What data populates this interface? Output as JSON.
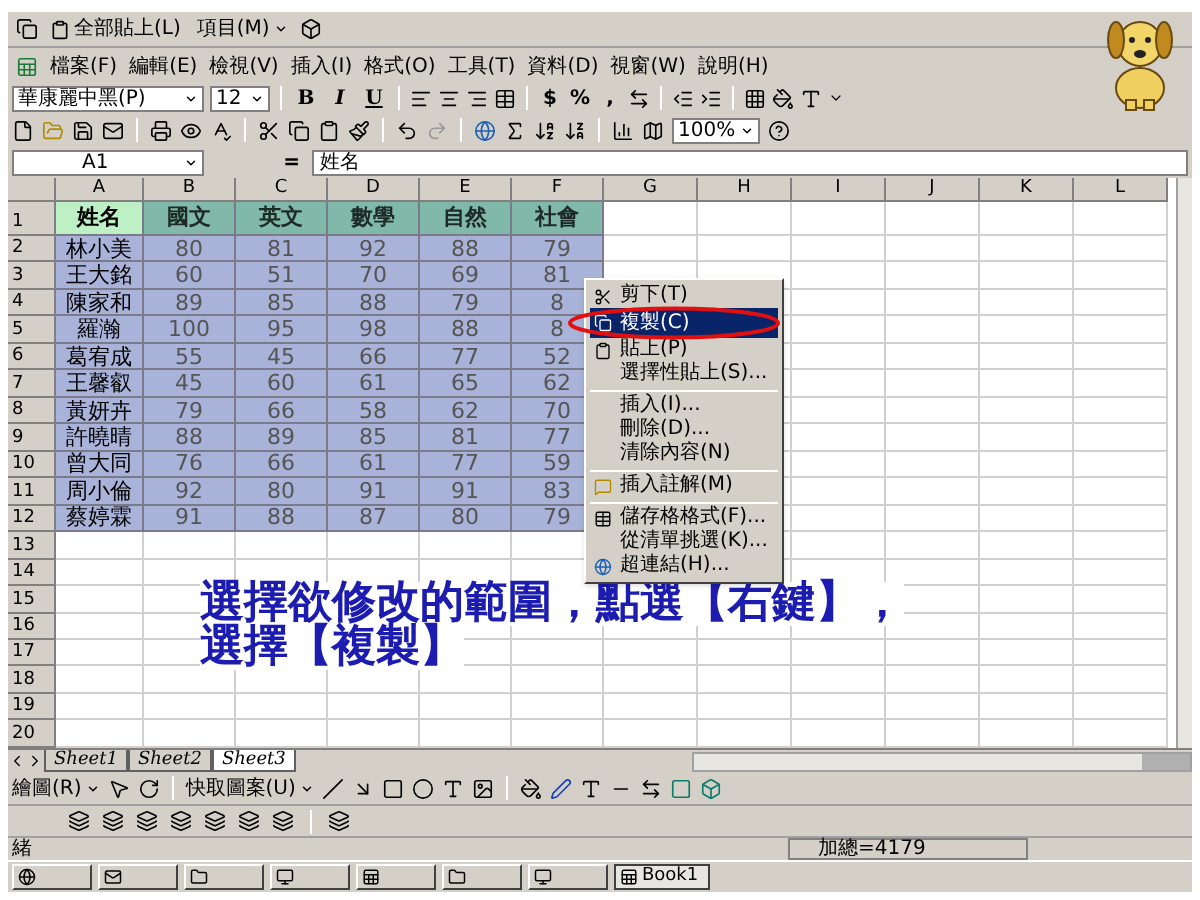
{
  "clipboard_toolbar": {
    "items": [
      {
        "label": "全部貼上(L)",
        "kind": "button"
      },
      {
        "label": "項目(M)",
        "kind": "dropdown"
      }
    ]
  },
  "menu_bar": [
    "檔案(F)",
    "編輯(E)",
    "檢視(V)",
    "插入(I)",
    "格式(O)",
    "工具(T)",
    "資料(D)",
    "視窗(W)",
    "說明(H)"
  ],
  "format_toolbar": {
    "font": "華康麗中黑(P)",
    "size": "12",
    "style_buttons": [
      "B",
      "I",
      "U"
    ],
    "number_buttons": [
      "$",
      "%",
      ","
    ]
  },
  "standard_toolbar": {
    "zoom": "100%"
  },
  "formula_bar": {
    "cell": "A1",
    "equals": "=",
    "value": "姓名"
  },
  "columns": [
    "A",
    "B",
    "C",
    "D",
    "E",
    "F",
    "G",
    "H",
    "I",
    "J",
    "K",
    "L"
  ],
  "rows": [
    {
      "number": "1",
      "kind": "header",
      "cells": [
        "姓名",
        "國文",
        "英文",
        "數學",
        "自然",
        "社會"
      ]
    },
    {
      "number": "2",
      "kind": "data",
      "cells": [
        "林小美",
        "80",
        "81",
        "92",
        "88",
        "79"
      ]
    },
    {
      "number": "3",
      "kind": "data",
      "cells": [
        "王大銘",
        "60",
        "51",
        "70",
        "69",
        "81"
      ]
    },
    {
      "number": "4",
      "kind": "data",
      "cells": [
        "陳家和",
        "89",
        "85",
        "88",
        "79",
        "8"
      ]
    },
    {
      "number": "5",
      "kind": "data",
      "cells": [
        "羅瀚",
        "100",
        "95",
        "98",
        "88",
        "8"
      ]
    },
    {
      "number": "6",
      "kind": "data",
      "cells": [
        "葛宥成",
        "55",
        "45",
        "66",
        "77",
        "52"
      ]
    },
    {
      "number": "7",
      "kind": "data",
      "cells": [
        "王馨叡",
        "45",
        "60",
        "61",
        "65",
        "62"
      ]
    },
    {
      "number": "8",
      "kind": "data",
      "cells": [
        "黃妍卉",
        "79",
        "66",
        "58",
        "62",
        "70"
      ]
    },
    {
      "number": "9",
      "kind": "data",
      "cells": [
        "許曉晴",
        "88",
        "89",
        "85",
        "81",
        "77"
      ]
    },
    {
      "number": "10",
      "kind": "data",
      "cells": [
        "曾大同",
        "76",
        "66",
        "61",
        "77",
        "59"
      ]
    },
    {
      "number": "11",
      "kind": "data",
      "cells": [
        "周小倫",
        "92",
        "80",
        "91",
        "91",
        "83"
      ]
    },
    {
      "number": "12",
      "kind": "data",
      "cells": [
        "蔡婷霖",
        "91",
        "88",
        "87",
        "80",
        "79"
      ]
    },
    {
      "number": "13",
      "kind": "empty"
    },
    {
      "number": "14",
      "kind": "empty"
    },
    {
      "number": "15",
      "kind": "empty"
    },
    {
      "number": "16",
      "kind": "empty"
    },
    {
      "number": "17",
      "kind": "empty"
    },
    {
      "number": "18",
      "kind": "empty"
    },
    {
      "number": "19",
      "kind": "empty"
    },
    {
      "number": "20",
      "kind": "empty"
    }
  ],
  "context_menu": [
    {
      "kind": "cut",
      "label": "剪下(T)",
      "selected": false
    },
    {
      "kind": "copy",
      "label": "複製(C)",
      "selected": true
    },
    {
      "kind": "paste",
      "label": "貼上(P)",
      "selected": false
    },
    {
      "kind": "item",
      "label": "選擇性貼上(S)...",
      "selected": false
    },
    {
      "kind": "separator"
    },
    {
      "kind": "item",
      "label": "插入(I)...",
      "selected": false
    },
    {
      "kind": "item",
      "label": "刪除(D)...",
      "selected": false
    },
    {
      "kind": "item",
      "label": "清除內容(N)",
      "selected": false
    },
    {
      "kind": "separator"
    },
    {
      "kind": "comment",
      "label": "插入註解(M)",
      "selected": false
    },
    {
      "kind": "separator"
    },
    {
      "kind": "format",
      "label": "儲存格格式(F)...",
      "selected": false
    },
    {
      "kind": "item",
      "label": "從清單挑選(K)...",
      "selected": false
    },
    {
      "kind": "link",
      "label": "超連結(H)...",
      "selected": false
    }
  ],
  "annotation": [
    "選擇欲修改的範圍，點選【右鍵】，",
    "選擇【複製】"
  ],
  "sheet_tabs": [
    {
      "label": "Sheet1",
      "selected": false
    },
    {
      "label": "Sheet2",
      "selected": false
    },
    {
      "label": "Sheet3",
      "selected": true
    }
  ],
  "drawing_toolbar": {
    "draw": "繪圖(R)",
    "autoshapes": "快取圖案(U)"
  },
  "status_bar": {
    "status": "緒",
    "sum": "加總=4179"
  },
  "taskbar": {
    "items": [
      {
        "label": "Book1",
        "selected": true
      }
    ]
  }
}
